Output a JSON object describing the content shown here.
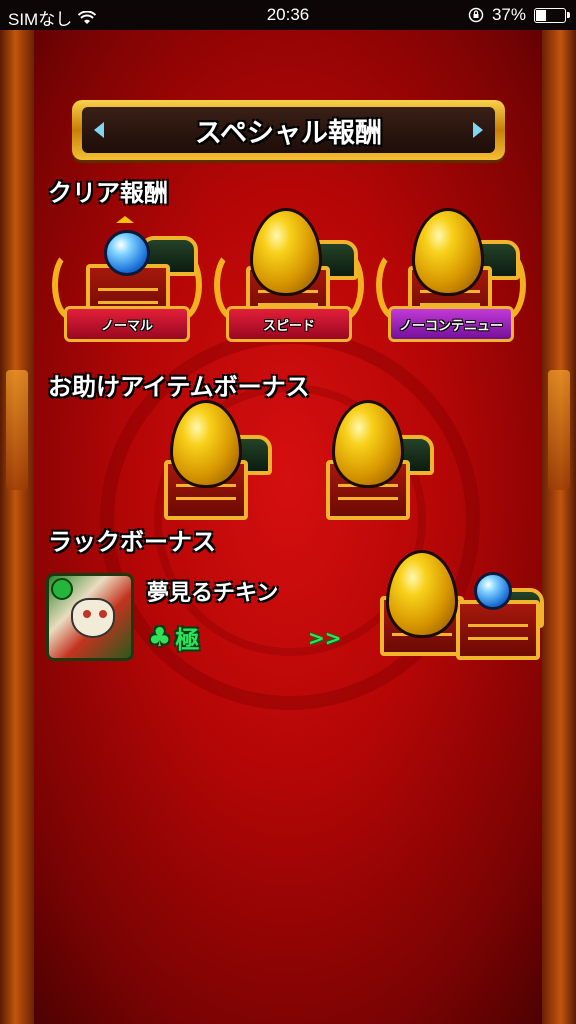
{
  "status_bar": {
    "carrier": "SIMなし",
    "time": "20:36",
    "battery": "37%",
    "battery_level": 0.37
  },
  "title": "スペシャル報酬",
  "sections": {
    "clear": "クリア報酬",
    "helper": "お助けアイテムボーナス",
    "luck": "ラックボーナス"
  },
  "clear_rewards": [
    {
      "label": "ノーマル",
      "color": "#e21f3a",
      "reward": "blue-orb-icon"
    },
    {
      "label": "スピード",
      "color": "#e21f3a",
      "reward": "golden-egg-icon"
    },
    {
      "label": "ノーコンテニュー",
      "color": "#c23ad6",
      "reward": "golden-egg-icon"
    }
  ],
  "luck_bonus": {
    "character_name": "夢見るチキン",
    "luck_rank": "極",
    "luck_symbol": "♣",
    "arrows": ">>"
  },
  "icons": {
    "wifi": "wifi-icon",
    "lock": "orientation-lock-icon",
    "battery": "battery-icon"
  }
}
